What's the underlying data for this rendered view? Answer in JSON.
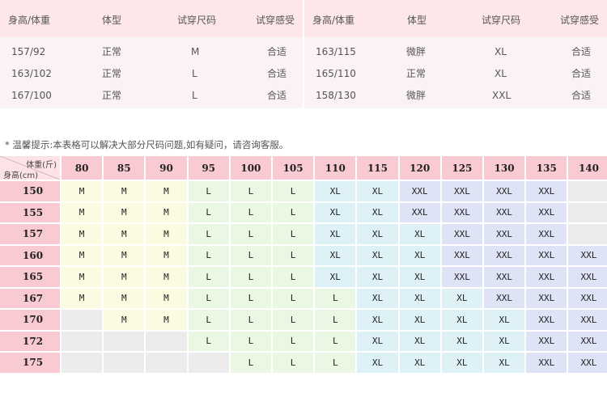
{
  "tryon": {
    "headers": [
      "身高/体重",
      "体型",
      "试穿尺码",
      "试穿感受"
    ],
    "left_rows": [
      [
        "157/92",
        "正常",
        "M",
        "合适"
      ],
      [
        "163/102",
        "正常",
        "L",
        "合适"
      ],
      [
        "167/100",
        "正常",
        "L",
        "合适"
      ]
    ],
    "right_rows": [
      [
        "163/115",
        "微胖",
        "XL",
        "合适"
      ],
      [
        "165/110",
        "正常",
        "XL",
        "合适"
      ],
      [
        "158/130",
        "微胖",
        "XXL",
        "合适"
      ]
    ]
  },
  "tip": "* 温馨提示:本表格可以解决大部分尺码问题,如有疑问，请咨询客服。",
  "size_chart": {
    "corner_weight_label": "体重(斤)",
    "corner_height_label": "身高(cm)",
    "weights": [
      "80",
      "85",
      "90",
      "95",
      "100",
      "105",
      "110",
      "115",
      "120",
      "125",
      "130",
      "135",
      "140"
    ],
    "heights": [
      "150",
      "155",
      "157",
      "160",
      "165",
      "167",
      "170",
      "172",
      "175"
    ],
    "rows": [
      [
        "M",
        "M",
        "M",
        "L",
        "L",
        "L",
        "XL",
        "XL",
        "XXL",
        "XXL",
        "XXL",
        "XXL",
        ""
      ],
      [
        "M",
        "M",
        "M",
        "L",
        "L",
        "L",
        "XL",
        "XL",
        "XXL",
        "XXL",
        "XXL",
        "XXL",
        ""
      ],
      [
        "M",
        "M",
        "M",
        "L",
        "L",
        "L",
        "XL",
        "XL",
        "XL",
        "XXL",
        "XXL",
        "XXL",
        ""
      ],
      [
        "M",
        "M",
        "M",
        "L",
        "L",
        "L",
        "XL",
        "XL",
        "XL",
        "XXL",
        "XXL",
        "XXL",
        "XXL"
      ],
      [
        "M",
        "M",
        "M",
        "L",
        "L",
        "L",
        "XL",
        "XL",
        "XL",
        "XXL",
        "XXL",
        "XXL",
        "XXL"
      ],
      [
        "M",
        "M",
        "M",
        "L",
        "L",
        "L",
        "L",
        "XL",
        "XL",
        "XL",
        "XXL",
        "XXL",
        "XXL"
      ],
      [
        "",
        "M",
        "M",
        "L",
        "L",
        "L",
        "L",
        "XL",
        "XL",
        "XL",
        "XL",
        "XXL",
        "XXL"
      ],
      [
        "",
        "",
        "",
        "L",
        "L",
        "L",
        "L",
        "XL",
        "XL",
        "XL",
        "XL",
        "XXL",
        "XXL"
      ],
      [
        "",
        "",
        "",
        "",
        "L",
        "L",
        "L",
        "XL",
        "XL",
        "XL",
        "XL",
        "XXL",
        "XXL"
      ]
    ],
    "colors": {
      "M": "#fbfbe2",
      "L": "#eaf7e3",
      "XL": "#def1f7",
      "XXL": "#dee3f5",
      "empty": "#ececec",
      "blank": "#ffffff"
    }
  }
}
